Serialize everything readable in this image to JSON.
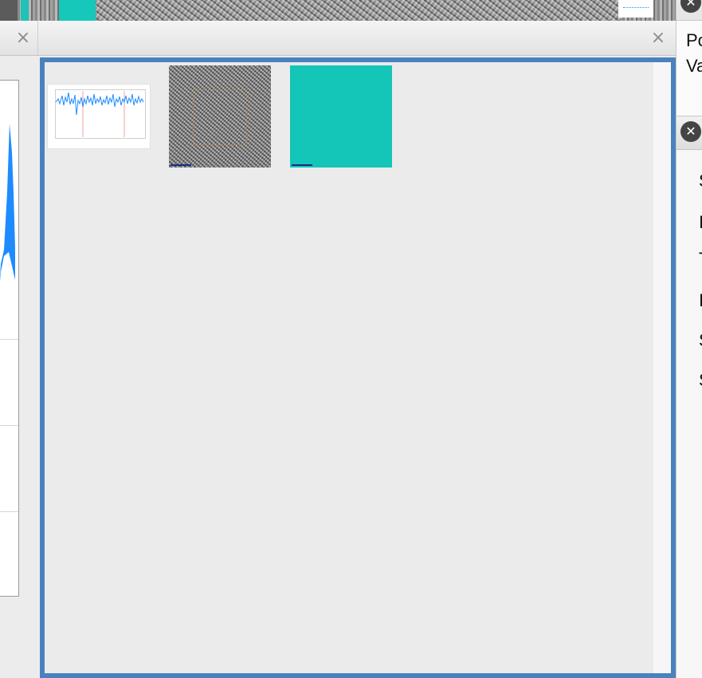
{
  "right_panel": {
    "info_lines": [
      "Po",
      "Va"
    ],
    "list_items": [
      "S",
      "I",
      "T",
      "I",
      "S",
      "S"
    ]
  },
  "close_glyph": "×",
  "circle_close_glyph": "✕",
  "colors": {
    "accent_border": "#4a82bd",
    "cyan_thumbnail": "#13c6b8",
    "plot_line": "#1e8cff"
  }
}
